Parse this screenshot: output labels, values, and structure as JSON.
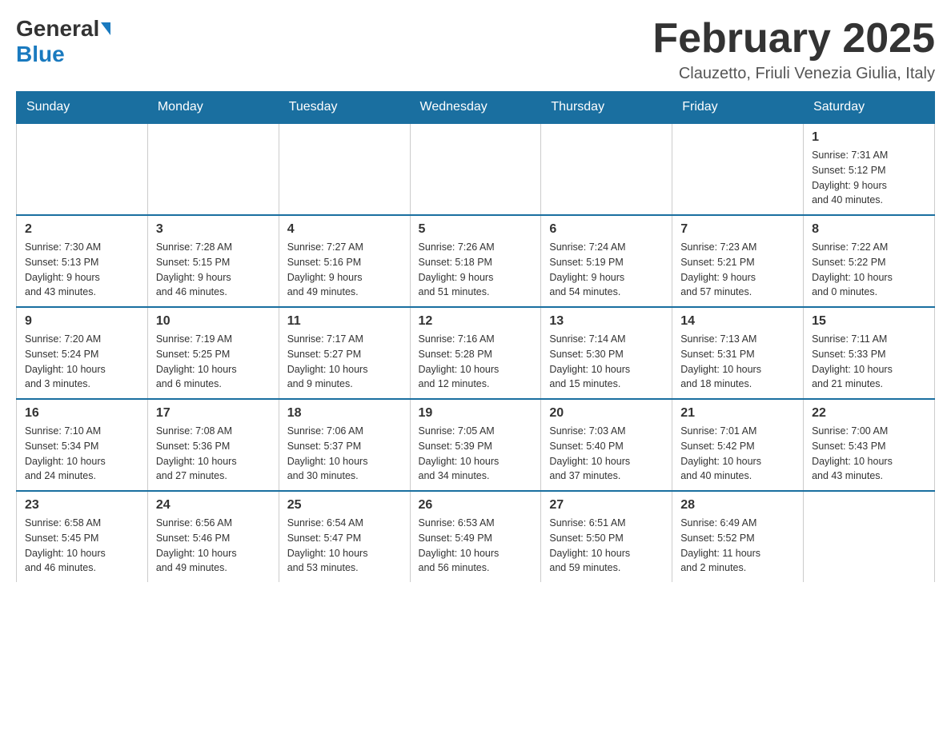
{
  "header": {
    "logo_general": "General",
    "logo_blue": "Blue",
    "month_title": "February 2025",
    "location": "Clauzetto, Friuli Venezia Giulia, Italy"
  },
  "weekdays": [
    "Sunday",
    "Monday",
    "Tuesday",
    "Wednesday",
    "Thursday",
    "Friday",
    "Saturday"
  ],
  "weeks": [
    [
      {
        "day": "",
        "info": ""
      },
      {
        "day": "",
        "info": ""
      },
      {
        "day": "",
        "info": ""
      },
      {
        "day": "",
        "info": ""
      },
      {
        "day": "",
        "info": ""
      },
      {
        "day": "",
        "info": ""
      },
      {
        "day": "1",
        "info": "Sunrise: 7:31 AM\nSunset: 5:12 PM\nDaylight: 9 hours\nand 40 minutes."
      }
    ],
    [
      {
        "day": "2",
        "info": "Sunrise: 7:30 AM\nSunset: 5:13 PM\nDaylight: 9 hours\nand 43 minutes."
      },
      {
        "day": "3",
        "info": "Sunrise: 7:28 AM\nSunset: 5:15 PM\nDaylight: 9 hours\nand 46 minutes."
      },
      {
        "day": "4",
        "info": "Sunrise: 7:27 AM\nSunset: 5:16 PM\nDaylight: 9 hours\nand 49 minutes."
      },
      {
        "day": "5",
        "info": "Sunrise: 7:26 AM\nSunset: 5:18 PM\nDaylight: 9 hours\nand 51 minutes."
      },
      {
        "day": "6",
        "info": "Sunrise: 7:24 AM\nSunset: 5:19 PM\nDaylight: 9 hours\nand 54 minutes."
      },
      {
        "day": "7",
        "info": "Sunrise: 7:23 AM\nSunset: 5:21 PM\nDaylight: 9 hours\nand 57 minutes."
      },
      {
        "day": "8",
        "info": "Sunrise: 7:22 AM\nSunset: 5:22 PM\nDaylight: 10 hours\nand 0 minutes."
      }
    ],
    [
      {
        "day": "9",
        "info": "Sunrise: 7:20 AM\nSunset: 5:24 PM\nDaylight: 10 hours\nand 3 minutes."
      },
      {
        "day": "10",
        "info": "Sunrise: 7:19 AM\nSunset: 5:25 PM\nDaylight: 10 hours\nand 6 minutes."
      },
      {
        "day": "11",
        "info": "Sunrise: 7:17 AM\nSunset: 5:27 PM\nDaylight: 10 hours\nand 9 minutes."
      },
      {
        "day": "12",
        "info": "Sunrise: 7:16 AM\nSunset: 5:28 PM\nDaylight: 10 hours\nand 12 minutes."
      },
      {
        "day": "13",
        "info": "Sunrise: 7:14 AM\nSunset: 5:30 PM\nDaylight: 10 hours\nand 15 minutes."
      },
      {
        "day": "14",
        "info": "Sunrise: 7:13 AM\nSunset: 5:31 PM\nDaylight: 10 hours\nand 18 minutes."
      },
      {
        "day": "15",
        "info": "Sunrise: 7:11 AM\nSunset: 5:33 PM\nDaylight: 10 hours\nand 21 minutes."
      }
    ],
    [
      {
        "day": "16",
        "info": "Sunrise: 7:10 AM\nSunset: 5:34 PM\nDaylight: 10 hours\nand 24 minutes."
      },
      {
        "day": "17",
        "info": "Sunrise: 7:08 AM\nSunset: 5:36 PM\nDaylight: 10 hours\nand 27 minutes."
      },
      {
        "day": "18",
        "info": "Sunrise: 7:06 AM\nSunset: 5:37 PM\nDaylight: 10 hours\nand 30 minutes."
      },
      {
        "day": "19",
        "info": "Sunrise: 7:05 AM\nSunset: 5:39 PM\nDaylight: 10 hours\nand 34 minutes."
      },
      {
        "day": "20",
        "info": "Sunrise: 7:03 AM\nSunset: 5:40 PM\nDaylight: 10 hours\nand 37 minutes."
      },
      {
        "day": "21",
        "info": "Sunrise: 7:01 AM\nSunset: 5:42 PM\nDaylight: 10 hours\nand 40 minutes."
      },
      {
        "day": "22",
        "info": "Sunrise: 7:00 AM\nSunset: 5:43 PM\nDaylight: 10 hours\nand 43 minutes."
      }
    ],
    [
      {
        "day": "23",
        "info": "Sunrise: 6:58 AM\nSunset: 5:45 PM\nDaylight: 10 hours\nand 46 minutes."
      },
      {
        "day": "24",
        "info": "Sunrise: 6:56 AM\nSunset: 5:46 PM\nDaylight: 10 hours\nand 49 minutes."
      },
      {
        "day": "25",
        "info": "Sunrise: 6:54 AM\nSunset: 5:47 PM\nDaylight: 10 hours\nand 53 minutes."
      },
      {
        "day": "26",
        "info": "Sunrise: 6:53 AM\nSunset: 5:49 PM\nDaylight: 10 hours\nand 56 minutes."
      },
      {
        "day": "27",
        "info": "Sunrise: 6:51 AM\nSunset: 5:50 PM\nDaylight: 10 hours\nand 59 minutes."
      },
      {
        "day": "28",
        "info": "Sunrise: 6:49 AM\nSunset: 5:52 PM\nDaylight: 11 hours\nand 2 minutes."
      },
      {
        "day": "",
        "info": ""
      }
    ]
  ]
}
